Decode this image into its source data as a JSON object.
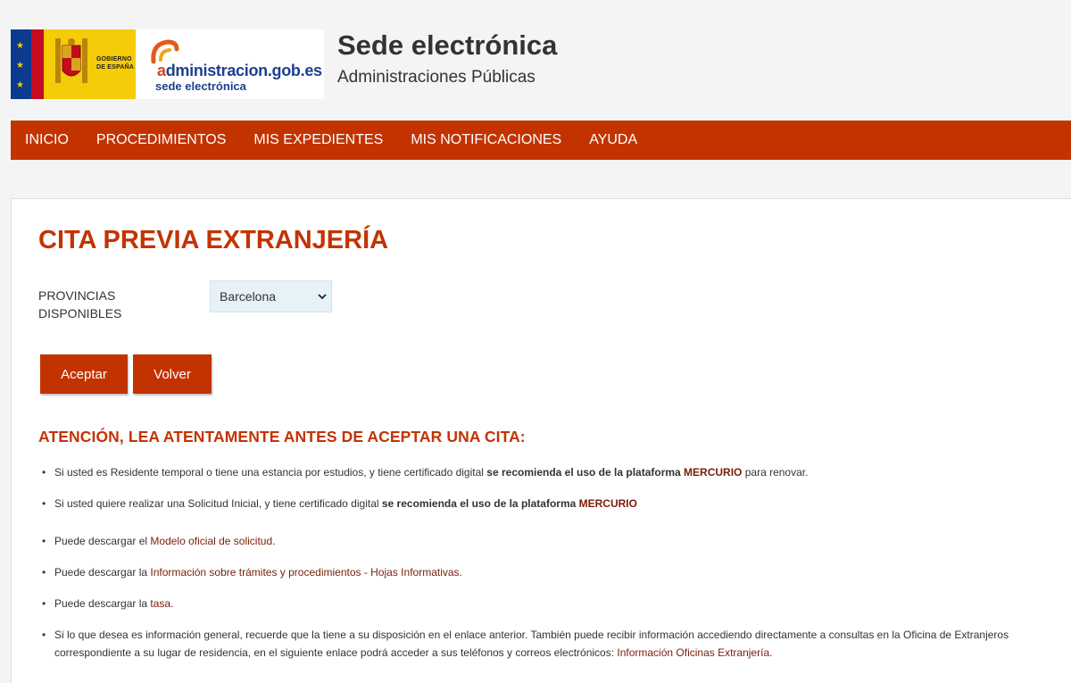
{
  "header": {
    "gob_line1": "GOBIERNO",
    "gob_line2": "DE ESPAÑA",
    "admin_prefix": "a",
    "admin_main": "dministracion.gob.es",
    "admin_sub": "sede electrónica",
    "title": "Sede electrónica",
    "subtitle": "Administraciones Públicas"
  },
  "nav": {
    "items": [
      "INICIO",
      "PROCEDIMIENTOS",
      "MIS EXPEDIENTES",
      "MIS NOTIFICACIONES",
      "AYUDA"
    ]
  },
  "main": {
    "title": "CITA PREVIA EXTRANJERÍA",
    "province_label_line1": "PROVINCIAS",
    "province_label_line2": "DISPONIBLES",
    "province_selected": "Barcelona",
    "accept_label": "Aceptar",
    "back_label": "Volver",
    "warning_title": "ATENCIÓN, LEA ATENTAMENTE ANTES DE ACEPTAR UNA CITA:",
    "bullets": {
      "b1_text": "Si usted es Residente temporal o tiene una estancia por estudios, y tiene certificado digital ",
      "b1_strong": "se recomienda el uso de la plataforma ",
      "b1_link": "MERCURIO",
      "b1_tail": " para renovar.",
      "b2_text": "Si usted quiere realizar una Solicitud Inicial, y tiene certificado digital ",
      "b2_strong": "se recomienda el uso de la plataforma ",
      "b2_link": "MERCURIO",
      "b3_text": "Puede descargar el ",
      "b3_link": "Modelo oficial de solicitud",
      "b3_tail": ".",
      "b4_text": "Puede descargar la ",
      "b4_link": "Información sobre trámites y procedimientos - Hojas Informativas",
      "b4_tail": ".",
      "b5_text": "Puede descargar la ",
      "b5_link": "tasa",
      "b5_tail": ".",
      "b6_text": "Si lo que desea es información general, recuerde que la tiene a su disposición en el enlace anterior. También puede recibir información accediendo directamente a consultas en la Oficina de Extranjeros correspondiente a su lugar de residencia, en el siguiente enlace podrá acceder a sus teléfonos y correos electrónicos: ",
      "b6_link": "Información Oficinas Extranjería",
      "b6_tail": "."
    }
  },
  "colors": {
    "brand_red": "#c33300",
    "link_dark_red": "#7a1d0a",
    "select_bg": "#e6f2f8"
  }
}
